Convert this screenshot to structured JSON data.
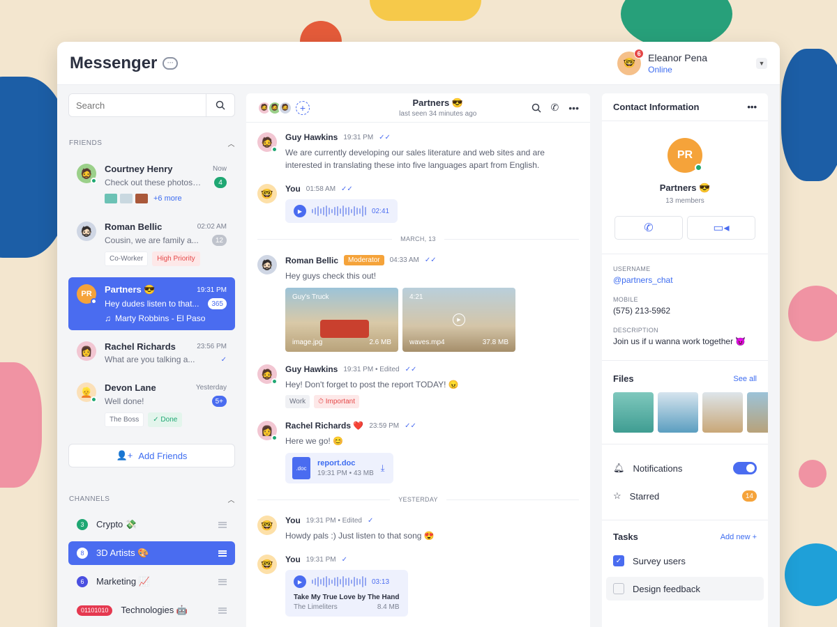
{
  "app": {
    "title": "Messenger"
  },
  "user": {
    "name": "Eleanor Pena",
    "status": "Online",
    "notifications": "6"
  },
  "sidebar": {
    "search_placeholder": "Search",
    "friends_heading": "FRIENDS",
    "chats": [
      {
        "name": "Courtney Henry",
        "time": "Now",
        "preview": "Check out these photos! 😍",
        "count": "4",
        "extra": "+6 more"
      },
      {
        "name": "Roman Bellic",
        "time": "02:02 AM",
        "preview": "Cousin, we are family a...",
        "count": "12",
        "tags": [
          "Co-Worker",
          "High Priority"
        ]
      },
      {
        "name": "Partners 😎",
        "initials": "PR",
        "time": "19:31 PM",
        "preview": "Hey dudes listen to that...",
        "count": "365",
        "song": "Marty Robbins - El Paso"
      },
      {
        "name": "Rachel Richards",
        "time": "23:56 PM",
        "preview": "What are you talking a..."
      },
      {
        "name": "Devon Lane",
        "time": "Yesterday",
        "preview": "Well done!",
        "count": "5+",
        "tags": [
          "The Boss",
          "✓ Done"
        ]
      }
    ],
    "add_friends": "Add Friends",
    "channels_heading": "CHANNELS",
    "channels": [
      {
        "num": "3",
        "name": "Crypto 💸",
        "color": "#1fa773"
      },
      {
        "num": "8",
        "name": "3D Artists 🎨",
        "color": "#4a6cf0"
      },
      {
        "num": "6",
        "name": "Marketing 📈",
        "color": "#4a4fe0"
      },
      {
        "num": "01101010",
        "name": "Technologies 🤖",
        "color": "#e53950"
      }
    ]
  },
  "conversation": {
    "title": "Partners 😎",
    "subtitle": "last seen 34 minutes ago",
    "messages": [
      {
        "name": "Guy Hawkins",
        "time": "19:31 PM",
        "text": "We are currently developing our sales literature and web sites and are interested in translating these into five languages apart from English."
      },
      {
        "name": "You",
        "time": "01:58 AM",
        "audio_duration": "02:41"
      },
      {
        "divider": "MARCH, 13"
      },
      {
        "name": "Roman Bellic",
        "badge": "Moderator",
        "time": "04:33 AM",
        "text": "Hey guys check this out!",
        "media": [
          {
            "title": "Guy's Truck",
            "file": "image.jpg",
            "size": "2.6 MB"
          },
          {
            "title": "4:21",
            "file": "waves.mp4",
            "size": "37.8 MB"
          }
        ]
      },
      {
        "name": "Guy Hawkins",
        "time": "19:31 PM • Edited",
        "text": "Hey! Don't forget to post the report TODAY! 😠",
        "chips": [
          "Work",
          "⏱ Important"
        ]
      },
      {
        "name": "Rachel Richards ❤️",
        "time": "23:59 PM",
        "text": "Here we go! 😊",
        "file": {
          "ext": ".doc",
          "name": "report.doc",
          "meta": "19:31 PM • 43 MB"
        }
      },
      {
        "divider": "YESTERDAY"
      },
      {
        "name": "You",
        "time": "19:31 PM • Edited",
        "text": "Howdy pals :) Just listen to that song 😍"
      },
      {
        "name": "You",
        "time": "19:31 PM",
        "audio_duration": "03:13",
        "song_title": "Take My True Love by The Hand",
        "song_artist": "The Limeliters",
        "song_size": "8.4 MB"
      }
    ]
  },
  "contact": {
    "heading": "Contact Information",
    "initials": "PR",
    "name": "Partners 😎",
    "members": "13 members",
    "username_label": "USERNAME",
    "username": "@partners_chat",
    "mobile_label": "MOBILE",
    "mobile": "(575) 213-5962",
    "description_label": "DESCRIPTION",
    "description": "Join us if u wanna work together 😈",
    "files_heading": "Files",
    "see_all": "See all",
    "notifications": "Notifications",
    "starred": "Starred",
    "starred_count": "14",
    "tasks_heading": "Tasks",
    "add_new": "Add new +",
    "tasks": [
      {
        "label": "Survey users",
        "done": true
      },
      {
        "label": "Design feedback",
        "done": false
      }
    ]
  },
  "colors": {
    "accent": "#4a6cf0",
    "online": "#1fa773",
    "warning": "#f5a33a",
    "danger": "#e54848"
  }
}
